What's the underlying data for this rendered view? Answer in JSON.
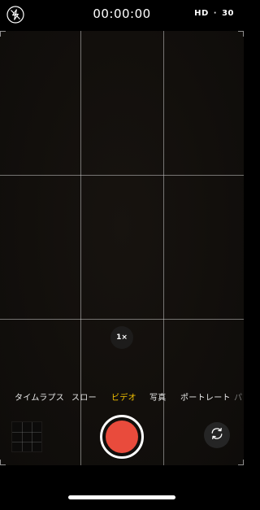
{
  "top_bar": {
    "timer": "00:00:00",
    "resolution": "HD",
    "separator": "·",
    "frame_rate": "30",
    "flash_icon": "flash-off-icon"
  },
  "viewfinder": {
    "zoom_label": "1×"
  },
  "modes": {
    "items": [
      "タイムラプス",
      "スロー",
      "ビデオ",
      "写真",
      "ポートレート",
      "パ"
    ],
    "active_index": 2,
    "active_color": "#f4c300"
  },
  "controls": {
    "shutter_color": "#e94b3c",
    "flip_icon": "camera-flip-icon",
    "thumbnail_icon": "last-photo-thumbnail"
  }
}
